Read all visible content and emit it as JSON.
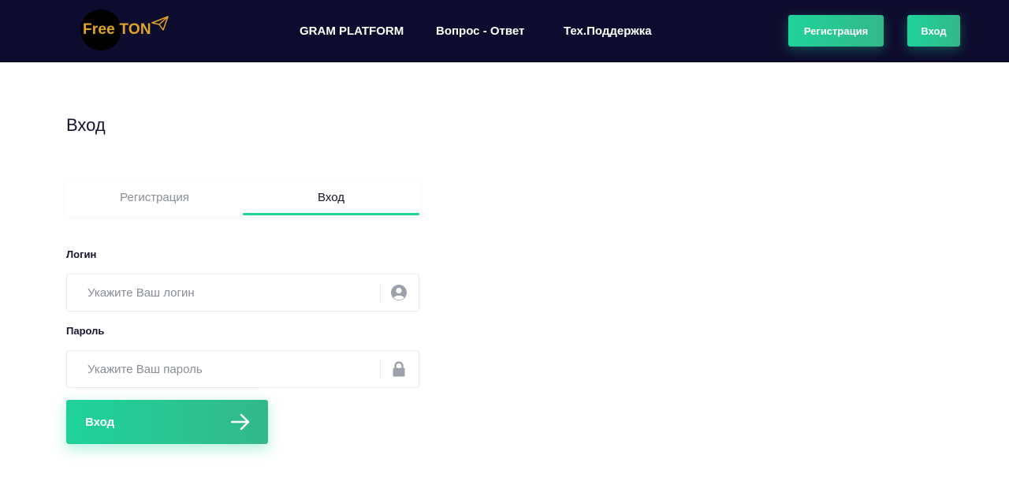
{
  "header": {
    "logo_text": "Free TON",
    "nav": [
      {
        "label": "GRAM PLATFORM"
      },
      {
        "label": "Вопрос - Ответ"
      },
      {
        "label": "Тех.Поддержка"
      }
    ],
    "register_button": "Регистрация",
    "login_button": "Вход"
  },
  "page": {
    "title": "Вход"
  },
  "tabs": [
    {
      "label": "Регистрация",
      "active": false
    },
    {
      "label": "Вход",
      "active": true
    }
  ],
  "form": {
    "login": {
      "label": "Логин",
      "placeholder": "Укажите Ваш логин",
      "value": "",
      "icon": "user-icon"
    },
    "password": {
      "label": "Пароль",
      "placeholder": "Укажите Ваш пароль",
      "value": "",
      "icon": "lock-icon"
    },
    "submit_label": "Вход",
    "submit_icon": "arrow-right-icon"
  },
  "colors": {
    "header_bg": "#0e0c2e",
    "accent": "#1ed39a",
    "logo": "#e0a526"
  }
}
